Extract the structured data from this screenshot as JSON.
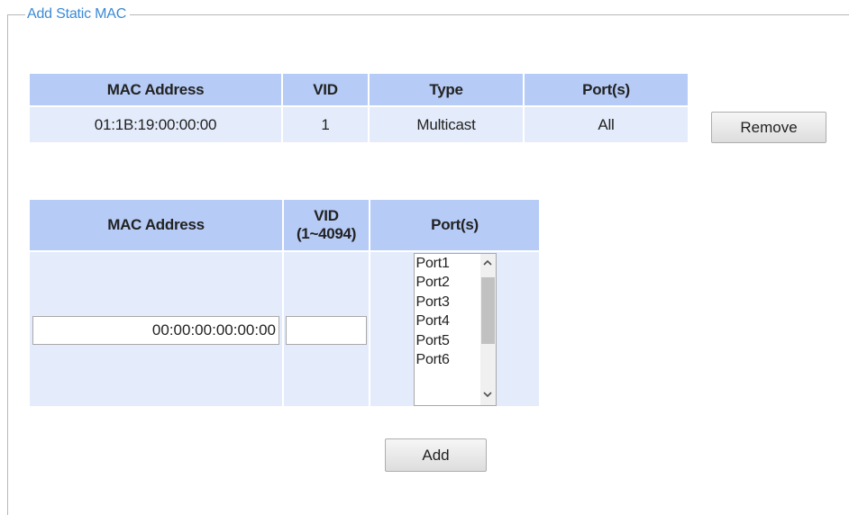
{
  "section": {
    "legend": "Add Static MAC"
  },
  "static_table": {
    "headers": [
      "MAC Address",
      "VID",
      "Type",
      "Port(s)"
    ],
    "rows": [
      {
        "mac": "01:1B:19:00:00:00",
        "vid": "1",
        "type": "Multicast",
        "ports": "All",
        "remove_label": "Remove"
      }
    ]
  },
  "add_form": {
    "headers": {
      "mac": "MAC Address",
      "vid_line1": "VID",
      "vid_line2": "(1~4094)",
      "ports": "Port(s)"
    },
    "mac_value": "00:00:00:00:00:00",
    "vid_value": "",
    "port_options": [
      "Port1",
      "Port2",
      "Port3",
      "Port4",
      "Port5",
      "Port6"
    ],
    "add_label": "Add"
  },
  "icons": {
    "scroll_up": "chevron-up-icon",
    "scroll_down": "chevron-down-icon"
  },
  "colors": {
    "header_bg": "#b6cbf5",
    "cell_bg": "#e4ecfb",
    "legend_text": "#3a8ad6"
  }
}
